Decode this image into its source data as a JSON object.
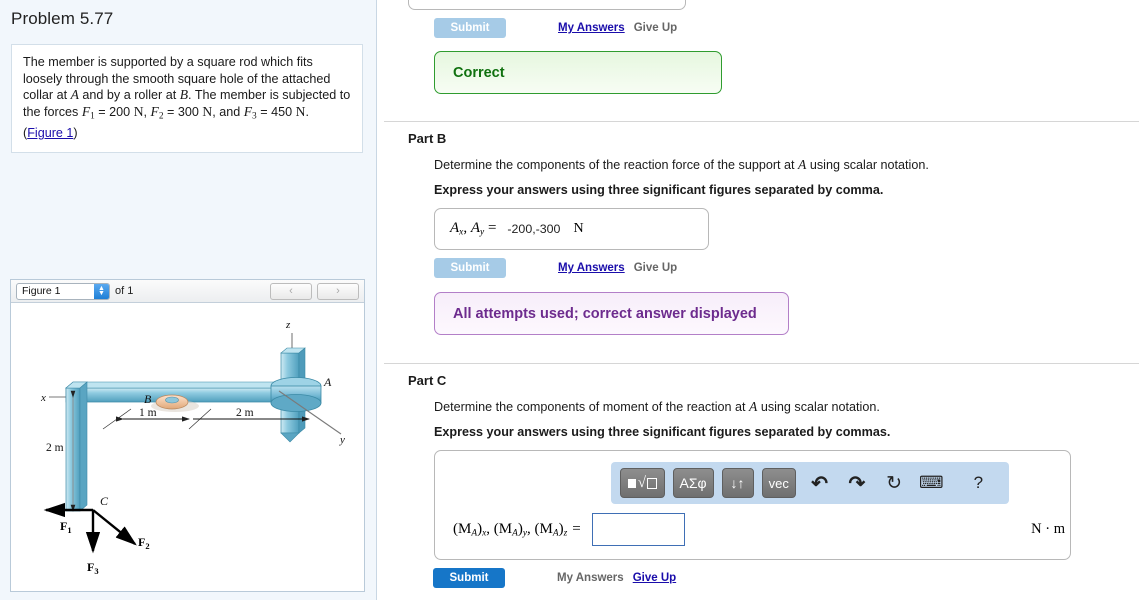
{
  "problem": {
    "title": "Problem 5.77",
    "statement_parts": {
      "t1": "The member is supported by a square rod which fits loosely through the smooth square hole of the attached collar at ",
      "A": "A",
      "t2": " and by a roller at ",
      "B": "B",
      "t3": ". The member is subjected to the forces ",
      "F1": "F",
      "f1sub": "1",
      "t4": " = 200",
      "N1": "N",
      "t5": ", ",
      "F2": "F",
      "f2sub": "2",
      "t6": " = 300",
      "N2": "N",
      "t7": ", and ",
      "F3": "F",
      "f3sub": "3",
      "t8": " = 450",
      "N3": "N",
      "t9": ". (",
      "figure_link": "Figure 1",
      "t10": ")"
    }
  },
  "figure_panel": {
    "select_value": "Figure 1",
    "of_label": "of 1",
    "prev_icon": "‹",
    "next_icon": "›",
    "spinner_up": "▲",
    "spinner_down": "▼"
  },
  "figure": {
    "axis_x": "x",
    "axis_y": "y",
    "axis_z": "z",
    "point_A": "A",
    "point_B": "B",
    "point_C": "C",
    "dim_1m": "1 m",
    "dim_2m_horizontal": "2 m",
    "dim_2m_vertical": "2 m",
    "force_1": "F",
    "force_1_sub": "1",
    "force_2": "F",
    "force_2_sub": "2",
    "force_3": "F",
    "force_3_sub": "3",
    "member_color": "#7fc4dc",
    "member_dark": "#3f93b5",
    "roller_color": "#f0c8a8"
  },
  "part_a": {
    "submit_label": "Submit",
    "my_answers_label": "My Answers",
    "give_up_label": "Give Up",
    "status_text": "Correct"
  },
  "part_b": {
    "heading": "Part B",
    "prompt_before": "Determine the components of the reaction force of the support at ",
    "prompt_symbol": "A",
    "prompt_after": " using scalar notation.",
    "instruction": "Express your answers using three significant figures separated by comma.",
    "answer_label_A1": "A",
    "answer_sub_x": "x",
    "answer_comma": ", ",
    "answer_label_A2": "A",
    "answer_sub_y": "y",
    "answer_equals": " =",
    "answer_value": "-200,-300",
    "answer_unit": "N",
    "submit_label": "Submit",
    "my_answers_label": "My Answers",
    "give_up_label": "Give Up",
    "status_text": "All attempts used; correct answer displayed"
  },
  "part_c": {
    "heading": "Part C",
    "prompt_before": "Determine the components of moment of the reaction at ",
    "prompt_symbol": "A",
    "prompt_after": " using scalar notation.",
    "instruction": "Express your answers using three significant figures separated by commas.",
    "toolbar": {
      "template_key": "√",
      "greek_key": "ΑΣφ",
      "arrows_key": "↓↑",
      "vec_key": "vec",
      "undo_icon": "↶",
      "redo_icon": "↷",
      "reset_icon": "↻",
      "keyboard_icon": "⌨",
      "help_icon": "?"
    },
    "answer_label": "(M",
    "answer_sub_A": "A",
    "answer_close_x": ")",
    "sub_x": "x",
    "sub_y": "y",
    "sub_z": "z",
    "answer_equals": "=",
    "answer_value": "",
    "answer_unit": "N · m",
    "submit_label": "Submit",
    "my_answers_label": "My Answers",
    "give_up_label": "Give Up"
  }
}
